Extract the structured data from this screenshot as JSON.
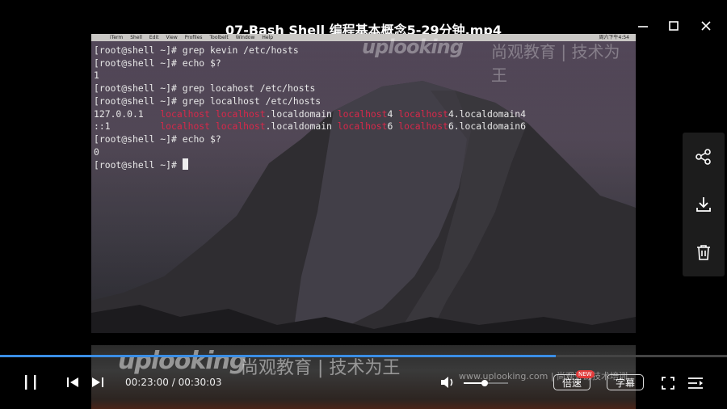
{
  "window": {
    "title": "07-Bash Shell 编程基本概念5-29分钟.mp4",
    "minimize_icon": "minimize-icon",
    "maximize_icon": "maximize-icon",
    "close_icon": "close-icon"
  },
  "mac_menubar": {
    "items": [
      "iTerm",
      "Shell",
      "Edit",
      "View",
      "Profiles",
      "Toolbelt",
      "Window",
      "Help"
    ],
    "clock": "周六下午4:54"
  },
  "watermark": {
    "brand": "uplooking",
    "slogan": "尚观教育 | 技术为王",
    "url": "www.uplooking.com | 尚观开源技术培训"
  },
  "terminal": {
    "lines": [
      [
        {
          "t": "[root@shell ~]# grep kevin /etc/hosts"
        }
      ],
      [
        {
          "t": "[root@shell ~]# echo $?"
        }
      ],
      [
        {
          "t": "1"
        }
      ],
      [
        {
          "t": "[root@shell ~]# grep locahost /etc/hosts"
        }
      ],
      [
        {
          "t": "[root@shell ~]# grep localhost /etc/hosts"
        }
      ],
      [
        {
          "t": "127.0.0.1   "
        },
        {
          "t": "localhost",
          "hl": true
        },
        {
          "t": " "
        },
        {
          "t": "localhost",
          "hl": true
        },
        {
          "t": ".localdomain "
        },
        {
          "t": "localhost",
          "hl": true
        },
        {
          "t": "4 "
        },
        {
          "t": "localhost",
          "hl": true
        },
        {
          "t": "4.localdomain4"
        }
      ],
      [
        {
          "t": "::1         "
        },
        {
          "t": "localhost",
          "hl": true
        },
        {
          "t": " "
        },
        {
          "t": "localhost",
          "hl": true
        },
        {
          "t": ".localdomain "
        },
        {
          "t": "localhost",
          "hl": true
        },
        {
          "t": "6 "
        },
        {
          "t": "localhost",
          "hl": true
        },
        {
          "t": "6.localdomain6"
        }
      ],
      [
        {
          "t": "[root@shell ~]# echo $?"
        }
      ],
      [
        {
          "t": "0"
        }
      ],
      [
        {
          "t": "[root@shell ~]# "
        },
        {
          "cursor": true
        }
      ]
    ]
  },
  "side_panel": {
    "share_icon": "share-icon",
    "download_icon": "download-icon",
    "delete_icon": "trash-icon"
  },
  "player": {
    "progress": 0.7645,
    "current_time": "00:23:00",
    "separator": " / ",
    "duration": "00:30:03",
    "volume": 0.47,
    "speed_label": "倍速",
    "speed_badge": "NEW",
    "subtitle_label": "字幕"
  },
  "colors": {
    "progress": "#3a8ee6",
    "highlight": "#d8284a",
    "badge": "#e23b3b"
  }
}
